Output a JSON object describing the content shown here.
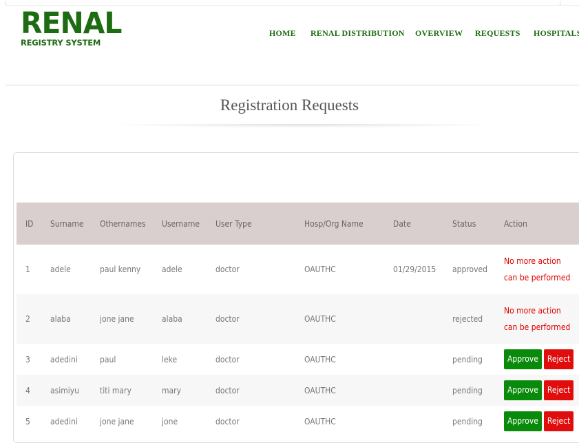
{
  "logo": {
    "main": "RENAL",
    "sub": "REGISTRY SYSTEM"
  },
  "nav": [
    {
      "label": "HOME"
    },
    {
      "label": "RENAL DISTRIBUTION"
    },
    {
      "label": "OVERVIEW"
    },
    {
      "label": "REQUESTS"
    },
    {
      "label": "HOSPITALS"
    }
  ],
  "page_title": "Registration Requests",
  "table": {
    "headers": [
      "ID",
      "Surname",
      "Othernames",
      "Username",
      "User Type",
      "Hosp/Org Name",
      "Date",
      "Status",
      "Action"
    ],
    "rows": [
      {
        "id": "1",
        "surname": "adele",
        "othernames": "paul kenny",
        "username": "adele",
        "user_type": "doctor",
        "org": "OAUTHC",
        "date": "01/29/2015",
        "status": "approved",
        "action": "No more action can be performed"
      },
      {
        "id": "2",
        "surname": "alaba",
        "othernames": "jone jane",
        "username": "alaba",
        "user_type": "doctor",
        "org": "OAUTHC",
        "date": "",
        "status": "rejected",
        "action": "No more action can be performed"
      },
      {
        "id": "3",
        "surname": "adedini",
        "othernames": "paul",
        "username": "leke",
        "user_type": "doctor",
        "org": "OAUTHC",
        "date": "",
        "status": "pending",
        "approve": "Approve",
        "reject": "Reject"
      },
      {
        "id": "4",
        "surname": "asimiyu",
        "othernames": "titi mary",
        "username": "mary",
        "user_type": "doctor",
        "org": "OAUTHC",
        "date": "",
        "status": "pending",
        "approve": "Approve",
        "reject": "Reject"
      },
      {
        "id": "5",
        "surname": "adedini",
        "othernames": "jone jane",
        "username": "jone",
        "user_type": "doctor",
        "org": "OAUTHC",
        "date": "",
        "status": "pending",
        "approve": "Approve",
        "reject": "Reject"
      }
    ]
  },
  "colors": {
    "brand_green": "#1d6b12",
    "approve": "#0a8a0a",
    "reject": "#e10d0d",
    "no_action": "#e00000",
    "header_bg": "#dacfcf"
  }
}
